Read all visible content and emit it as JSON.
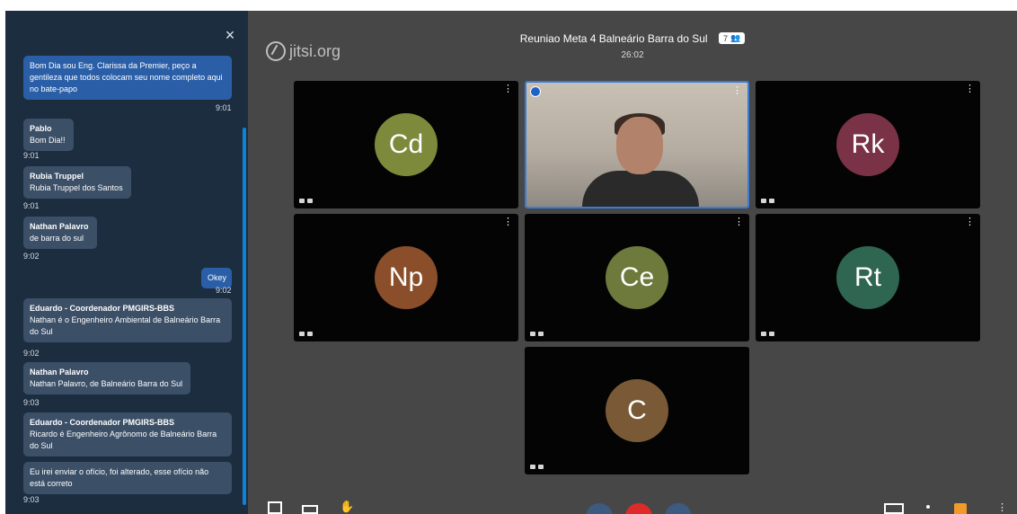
{
  "chat": {
    "close_icon": "×",
    "messages": [
      {
        "text": "Bom Dia sou Eng. Clarissa da Premier, peço a gentileza que todos colocam seu nome completo aqui no bate-papo",
        "time": "9:01"
      },
      {
        "author": "Pablo",
        "text": "Bom Dia!!",
        "time": "9:01"
      },
      {
        "author": "Rubia Truppel",
        "text": "Rubia Truppel dos Santos",
        "time": "9:01"
      },
      {
        "author": "Nathan Palavro",
        "text": "de barra do sul",
        "time": "9:02"
      },
      {
        "text": "Okey",
        "time": "9:02"
      },
      {
        "author": "Eduardo - Coordenador PMGIRS-BBS",
        "text": "Nathan é o Engenheiro Ambiental de Balneário Barra do Sul",
        "time": "9:02"
      },
      {
        "author": "Nathan Palavro",
        "text": "Nathan Palavro, de Balneário Barra do Sul",
        "time": "9:03"
      },
      {
        "author": "Eduardo - Coordenador PMGIRS-BBS",
        "text": "Ricardo é Engenheiro Agrônomo de Balneário Barra do Sul",
        "time": ""
      },
      {
        "text": "Eu irei enviar o ofício, foi alterado, esse ofício não está correto",
        "time": "9:03"
      }
    ]
  },
  "header": {
    "logo": "jitsi.org",
    "title": "Reuniao Meta 4 Balneário Barra do Sul",
    "participant_count": "7",
    "timer": "26:02"
  },
  "tiles": [
    {
      "initials": "Cd",
      "color": "#7d8a3b"
    },
    {
      "initials": "",
      "camera": true
    },
    {
      "initials": "Rk",
      "color": "#7a3346"
    },
    {
      "initials": "Np",
      "color": "#8a4e2b"
    },
    {
      "initials": "Ce",
      "color": "#6d7a3c"
    },
    {
      "initials": "Rt",
      "color": "#2f6651"
    },
    {
      "initials": "C",
      "color": "#7a5a36"
    }
  ],
  "icons": {
    "tile_menu": "⋮",
    "badge_icon": "👥",
    "raise_hand": "✋"
  },
  "colors": {
    "accent": "#0f82d8",
    "hangup": "#e02a2a",
    "own_bubble": "#2a5fa8"
  }
}
